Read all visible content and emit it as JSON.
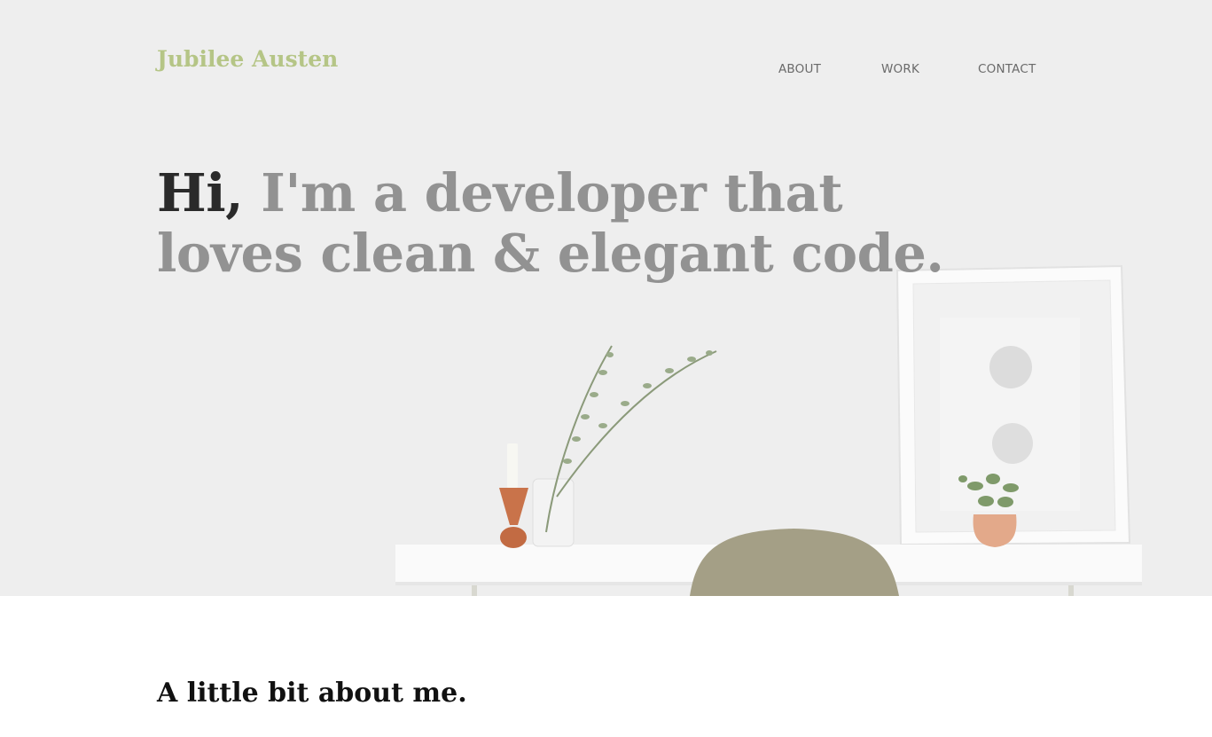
{
  "header": {
    "brand": "Jubilee Austen",
    "nav": [
      {
        "label": "ABOUT"
      },
      {
        "label": "WORK"
      },
      {
        "label": "CONTACT"
      }
    ]
  },
  "hero": {
    "greeting": "Hi,",
    "headline": " I'm a developer that loves clean & elegant code."
  },
  "about": {
    "title": "A little bit about me."
  },
  "colors": {
    "brand": "#b5c586",
    "headline_muted": "#929292",
    "headline_strong": "#2a2a2a",
    "nav_text": "#6a6a6a"
  }
}
